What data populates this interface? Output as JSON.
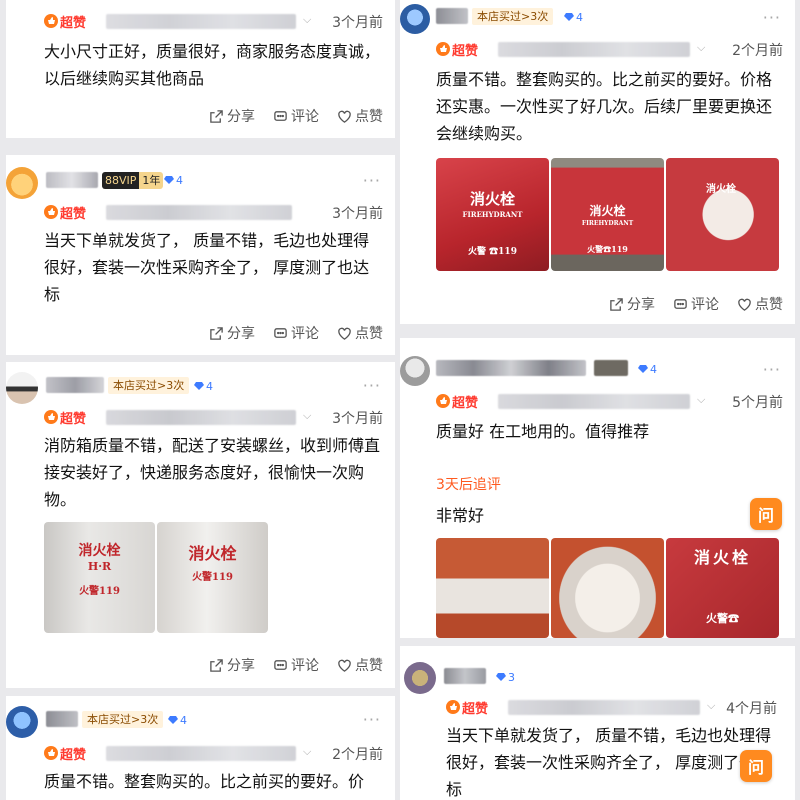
{
  "colors": {
    "accent": "#ff3b30",
    "followup": "#ff5a1f",
    "level": "#3d7bff",
    "ask_button": "#ff8a1f"
  },
  "badge_label": "超赞",
  "actions": {
    "share": "分享",
    "comment": "评论",
    "like": "点赞"
  },
  "ask_button_label": "问",
  "icons": {
    "share": "share-icon",
    "comment": "comment-icon",
    "like": "heart-icon",
    "badge": "thumbs-up-icon",
    "level": "diamond-icon",
    "more": "more-dots-icon",
    "chevron": "chevron-down-icon"
  },
  "left_reviews": [
    {
      "date": "3个月前",
      "text": "大小尺寸正好，质量很好，商家服务态度真诚，以后继续购买其他商品"
    },
    {
      "vip": "88VIP",
      "vip_year": "1年",
      "level": "4",
      "date": "3个月前",
      "text": "当天下单就发货了， 质量不错，毛边也处理得很好，套装一次性采购齐全了， 厚度测了也达标"
    },
    {
      "repeat_tag": "本店买过>3次",
      "level": "4",
      "date": "3个月前",
      "text": "消防箱质量不错，配送了安装螺丝，收到师傅直接安装好了，快递服务态度好，很愉快一次购物。",
      "photos": [
        {
          "title": "消火栓",
          "line2": "H·R",
          "line3": "火警119"
        },
        {
          "title": "消火栓",
          "line3": "火警119"
        }
      ]
    },
    {
      "repeat_tag": "本店买过>3次",
      "level": "4",
      "date": "2个月前",
      "text": "质量不错。整套购买的。比之前买的要好。价"
    }
  ],
  "right_reviews": [
    {
      "repeat_tag": "本店买过>3次",
      "level": "4",
      "date": "2个月前",
      "text": "质量不错。整套购买的。比之前买的要好。价格还实惠。一次性买了好几次。后续厂里要更换还会继续购买。",
      "photos": [
        {
          "title": "消火栓",
          "line2": "FIREHYDRANT",
          "line3": "火警 ☎119"
        },
        {
          "title": "消火栓",
          "line2": "FIREHYDRANT",
          "line3": "火警☎119"
        },
        {
          "title": "消火栓"
        }
      ]
    },
    {
      "level": "4",
      "date": "5个月前",
      "text": "质量好 在工地用的。值得推荐",
      "followup_label": "3天后追评",
      "followup_text": "非常好",
      "photos": [
        {},
        {},
        {
          "title": "消火栓",
          "line3": "火警☎"
        }
      ]
    },
    {
      "level": "3",
      "date": "4个月前",
      "text": "当天下单就发货了， 质量不错，毛边也处理得很好，套装一次性采购齐全了， 厚度测了也达标"
    }
  ]
}
